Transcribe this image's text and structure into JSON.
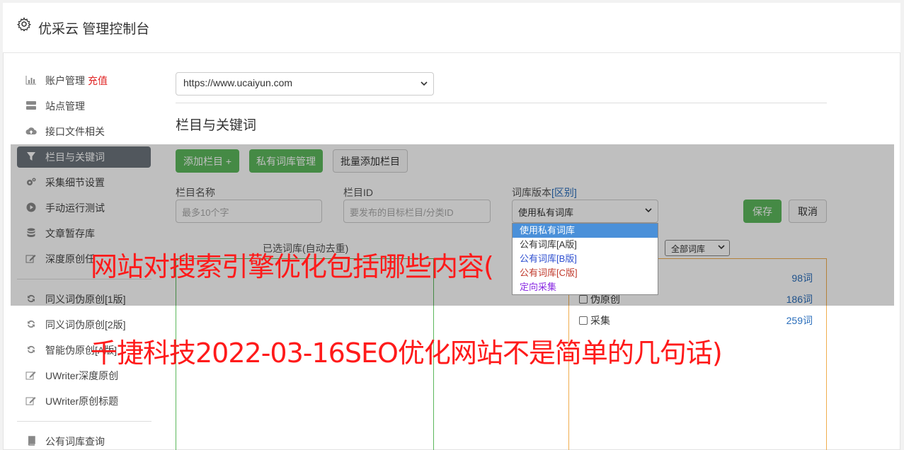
{
  "header": {
    "title": "优采云 管理控制台",
    "icon": "gear-icon"
  },
  "sidebar": {
    "items": [
      {
        "label": "账户管理",
        "extra": "充值",
        "icon": "bar-chart-icon"
      },
      {
        "label": "站点管理",
        "icon": "server-icon"
      },
      {
        "label": "接口文件相关",
        "icon": "cloud-upload-icon"
      },
      {
        "label": "栏目与关键词",
        "icon": "filter-icon",
        "active": true
      },
      {
        "label": "采集细节设置",
        "icon": "cogs-icon"
      },
      {
        "label": "手动运行测试",
        "icon": "play-circle-icon"
      },
      {
        "label": "文章暂存库",
        "icon": "database-icon"
      },
      {
        "label": "深度原创任",
        "icon": "edit-icon"
      },
      {
        "label": "同义词伪原创[1版]",
        "icon": "refresh-icon"
      },
      {
        "label": "同义词伪原创[2版]",
        "icon": "refresh-icon"
      },
      {
        "label": "智能伪原创[A版]",
        "icon": "refresh-icon"
      },
      {
        "label": "UWriter深度原创",
        "icon": "edit-icon"
      },
      {
        "label": "UWriter原创标题",
        "icon": "edit-icon"
      },
      {
        "label": "公有词库查询",
        "icon": "book-icon"
      }
    ]
  },
  "main": {
    "site_select": "https://www.ucaiyun.com",
    "section_title": "栏目与关键词",
    "buttons": {
      "add_column": "添加栏目 +",
      "private_lib": "私有词库管理",
      "batch_add": "批量添加栏目",
      "save": "保存",
      "cancel": "取消"
    },
    "form": {
      "column_name_label": "栏目名称",
      "column_name_placeholder": "最多10个字",
      "column_id_label": "栏目ID",
      "column_id_placeholder": "要发布的目标栏目/分类ID",
      "lib_version_label": "词库版本",
      "lib_version_link": "[区别]",
      "lib_version_value": "使用私有词库"
    },
    "dropdown_options": [
      "使用私有词库",
      "公有词库[A版]",
      "公有词库[B版]",
      "公有词库[C版]",
      "定向采集"
    ],
    "selected_words_label": "已选词库(自动去重)",
    "lib_filter": "全部词库",
    "lib_rows": [
      {
        "name": "",
        "count": "98词"
      },
      {
        "name": "伪原创",
        "count": "186词"
      },
      {
        "name": "采集",
        "count": "259词"
      }
    ]
  },
  "overlay_text": {
    "line1": "网站对搜索引擎优化包括哪些内容(",
    "line2": "千捷科技2022-03-16SEO优化网站不是简单的几句话)"
  },
  "colors": {
    "accent_green": "#5cb85c",
    "active_nav": "#6c757d",
    "headline": "#ff1a1a",
    "link": "#2a6ebb"
  }
}
